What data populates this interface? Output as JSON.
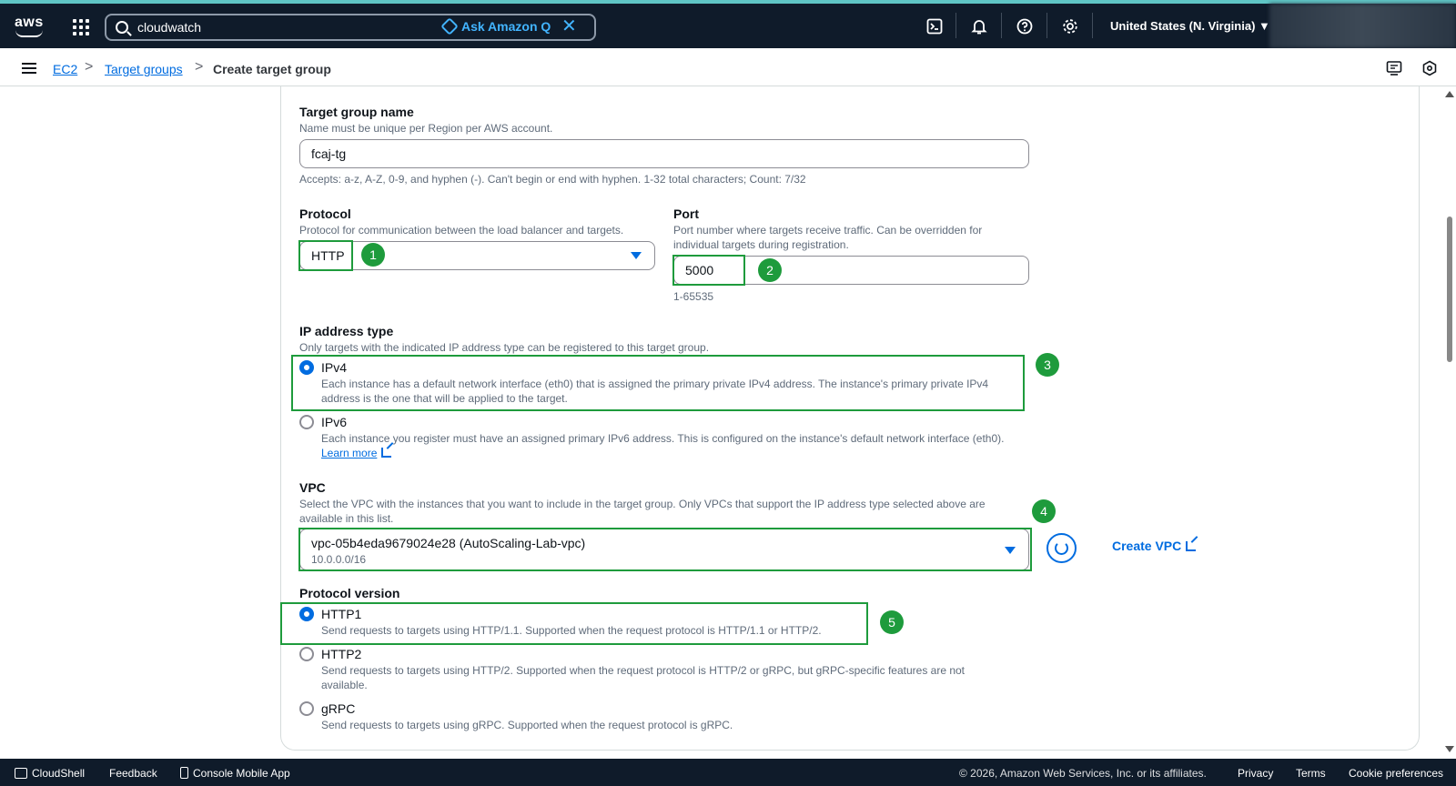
{
  "topbar": {
    "logo_text": "aws",
    "search_value": "cloudwatch",
    "ask_q_label": "Ask Amazon Q",
    "close_glyph": "✕",
    "region_label": "United States (N. Virginia) ▼",
    "icons": [
      "apps-grid-icon",
      "search-icon",
      "cloudshell-icon",
      "bell-icon",
      "help-icon",
      "settings-icon"
    ]
  },
  "breadcrumb": {
    "items": [
      "EC2",
      "Target groups"
    ],
    "current": "Create target group",
    "separator": ">"
  },
  "form": {
    "name": {
      "label": "Target group name",
      "description": "Name must be unique per Region per AWS account.",
      "value": "fcaj-tg",
      "hint": "Accepts: a-z, A-Z, 0-9, and hyphen (-). Can't begin or end with hyphen. 1-32 total characters; Count: 7/32"
    },
    "protocol": {
      "label": "Protocol",
      "description": "Protocol for communication between the load balancer and targets.",
      "value": "HTTP"
    },
    "port": {
      "label": "Port",
      "description": "Port number where targets receive traffic. Can be overridden for individual targets during registration.",
      "value": "5000",
      "hint": "1-65535"
    },
    "ip_type": {
      "label": "IP address type",
      "description": "Only targets with the indicated IP address type can be registered to this target group.",
      "options": [
        {
          "label": "IPv4",
          "description": "Each instance has a default network interface (eth0) that is assigned the primary private IPv4 address. The instance's primary private IPv4 address is the one that will be applied to the target.",
          "selected": true
        },
        {
          "label": "IPv6",
          "description": "Each instance you register must have an assigned primary IPv6 address. This is configured on the instance's default network interface (eth0).",
          "selected": false
        }
      ],
      "learn_more": "Learn more"
    },
    "vpc": {
      "label": "VPC",
      "description": "Select the VPC with the instances that you want to include in the target group. Only VPCs that support the IP address type selected above are available in this list.",
      "value": "vpc-05b4eda9679024e28 (AutoScaling-Lab-vpc)",
      "cidr": "10.0.0.0/16",
      "create_label": "Create VPC"
    },
    "protocol_version": {
      "label": "Protocol version",
      "options": [
        {
          "label": "HTTP1",
          "description": "Send requests to targets using HTTP/1.1. Supported when the request protocol is HTTP/1.1 or HTTP/2.",
          "selected": true
        },
        {
          "label": "HTTP2",
          "description": "Send requests to targets using HTTP/2. Supported when the request protocol is HTTP/2 or gRPC, but gRPC-specific features are not available.",
          "selected": false
        },
        {
          "label": "gRPC",
          "description": "Send requests to targets using gRPC. Supported when the request protocol is gRPC.",
          "selected": false
        }
      ]
    }
  },
  "annotations": [
    "1",
    "2",
    "3",
    "4",
    "5"
  ],
  "colors": {
    "topbar": "#0f1b2a",
    "link": "#006ce0",
    "highlight": "#1e9b3c",
    "accent_teal": "#5fc5c5"
  },
  "footer": {
    "cloudshell": "CloudShell",
    "feedback": "Feedback",
    "mobile_app": "Console Mobile App",
    "copyright": "© 2026, Amazon Web Services, Inc. or its affiliates.",
    "privacy": "Privacy",
    "terms": "Terms",
    "cookies": "Cookie preferences"
  }
}
